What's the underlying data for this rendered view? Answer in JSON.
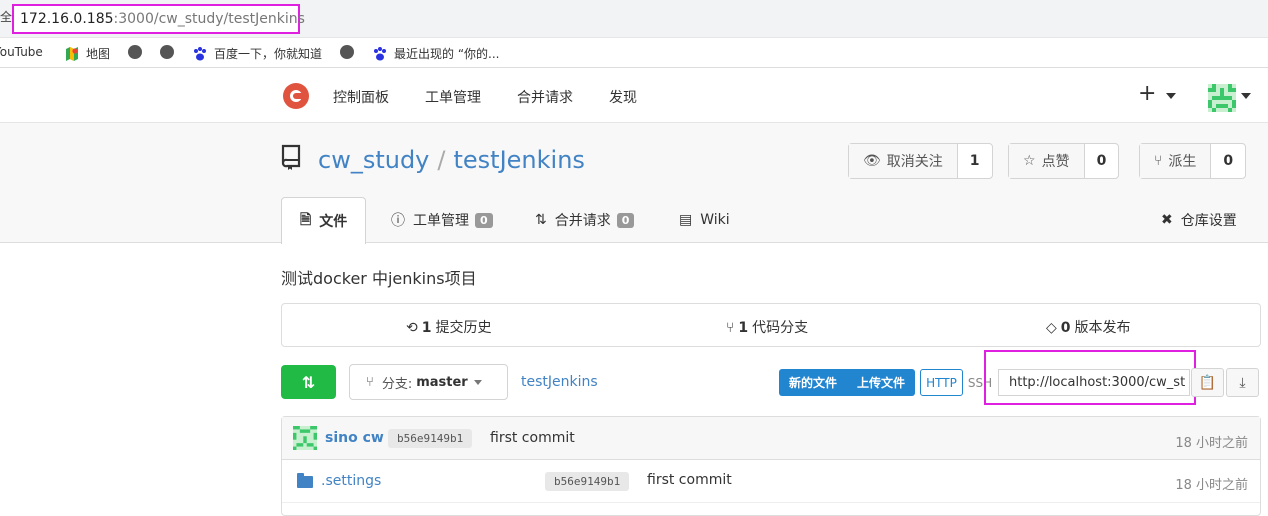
{
  "browser": {
    "url_host": "172.16.0.185",
    "url_path": ":3000/cw_study/testJenkins",
    "edge_char": "全",
    "bookmarks": [
      "YouTube",
      "地图",
      "",
      "",
      "百度一下，你就知道",
      "",
      "最近出现的 “你的..."
    ]
  },
  "nav": {
    "links": [
      "控制面板",
      "工单管理",
      "合并请求",
      "发现"
    ],
    "plus": "+"
  },
  "repo": {
    "owner": "cw_study",
    "separator": "/",
    "name": "testJenkins",
    "watch_label": "取消关注",
    "watch_count": "1",
    "star_label": "点赞",
    "star_count": "0",
    "fork_label": "派生",
    "fork_count": "0"
  },
  "tabs": {
    "files": "文件",
    "issues": "工单管理",
    "issues_count": "0",
    "pulls": "合并请求",
    "pulls_count": "0",
    "wiki": "Wiki",
    "settings": "仓库设置"
  },
  "description": "测试docker 中jenkins项目",
  "stats": {
    "commits_num": "1",
    "commits_label": "提交历史",
    "branches_num": "1",
    "branches_label": "代码分支",
    "releases_num": "0",
    "releases_label": "版本发布"
  },
  "toolbar": {
    "branch_prefix": "分支:",
    "branch_name": "master",
    "breadcrumb": "testJenkins",
    "new_file": "新的文件",
    "upload_file": "上传文件",
    "http": "HTTP",
    "ssh": "SSH",
    "clone_url": "http://localhost:3000/cw_st"
  },
  "latest_commit": {
    "author": "sino cw",
    "sha": "b56e9149b1",
    "message": "first commit",
    "time": "18 小时之前"
  },
  "files": [
    {
      "name": ".settings",
      "sha": "b56e9149b1",
      "message": "first commit",
      "time": "18 小时之前"
    }
  ],
  "colors": {
    "link": "#4183c4",
    "green": "#21ba45",
    "blue": "#2185d0",
    "highlight": "#e020e0",
    "logo": "#e0533f"
  }
}
